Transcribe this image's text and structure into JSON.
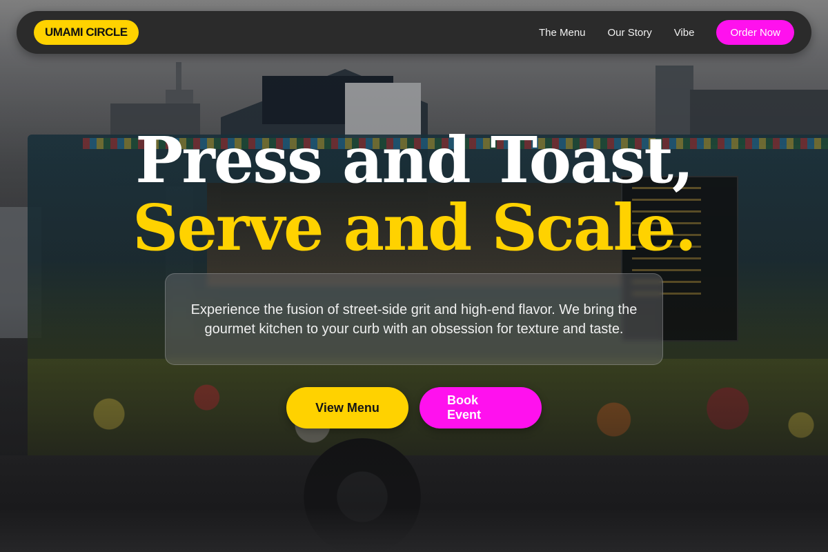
{
  "nav": {
    "logo": "UMAMI CIRCLE",
    "links": [
      "The Menu",
      "Our Story",
      "Vibe"
    ],
    "order_label": "Order Now"
  },
  "hero": {
    "headline_line1": "Press and Toast,",
    "headline_line2": "Serve and Scale.",
    "tagline": "Experience the fusion of street-side grit and high-end flavor. We bring the gourmet kitchen to your curb with an obsession for texture and taste.",
    "cta_primary": "View Menu",
    "cta_secondary": "Book Event"
  },
  "colors": {
    "accent_yellow": "#ffd200",
    "accent_magenta": "#ff11ee",
    "nav_bg": "#2b2b2b"
  }
}
